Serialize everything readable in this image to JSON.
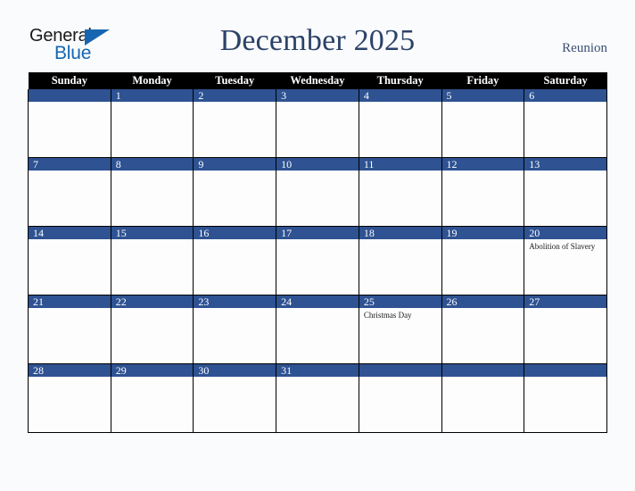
{
  "brand": {
    "name_top": "General",
    "name_bottom": "Blue",
    "triangle_icon": "triangle-icon",
    "color_black": "#1a1a1a",
    "color_blue": "#1565b0"
  },
  "header": {
    "title": "December 2025",
    "region": "Reunion",
    "title_color": "#2b4268"
  },
  "calendar": {
    "weekday_headers": [
      "Sunday",
      "Monday",
      "Tuesday",
      "Wednesday",
      "Thursday",
      "Friday",
      "Saturday"
    ],
    "header_bg": "#000000",
    "daynum_bg": "#2e5292",
    "cell_bg": "#fdfdfe",
    "weeks": [
      [
        {
          "day": "",
          "events": []
        },
        {
          "day": "1",
          "events": []
        },
        {
          "day": "2",
          "events": []
        },
        {
          "day": "3",
          "events": []
        },
        {
          "day": "4",
          "events": []
        },
        {
          "day": "5",
          "events": []
        },
        {
          "day": "6",
          "events": []
        }
      ],
      [
        {
          "day": "7",
          "events": []
        },
        {
          "day": "8",
          "events": []
        },
        {
          "day": "9",
          "events": []
        },
        {
          "day": "10",
          "events": []
        },
        {
          "day": "11",
          "events": []
        },
        {
          "day": "12",
          "events": []
        },
        {
          "day": "13",
          "events": []
        }
      ],
      [
        {
          "day": "14",
          "events": []
        },
        {
          "day": "15",
          "events": []
        },
        {
          "day": "16",
          "events": []
        },
        {
          "day": "17",
          "events": []
        },
        {
          "day": "18",
          "events": []
        },
        {
          "day": "19",
          "events": []
        },
        {
          "day": "20",
          "events": [
            "Abolition of Slavery"
          ]
        }
      ],
      [
        {
          "day": "21",
          "events": []
        },
        {
          "day": "22",
          "events": []
        },
        {
          "day": "23",
          "events": []
        },
        {
          "day": "24",
          "events": []
        },
        {
          "day": "25",
          "events": [
            "Christmas Day"
          ]
        },
        {
          "day": "26",
          "events": []
        },
        {
          "day": "27",
          "events": []
        }
      ],
      [
        {
          "day": "28",
          "events": []
        },
        {
          "day": "29",
          "events": []
        },
        {
          "day": "30",
          "events": []
        },
        {
          "day": "31",
          "events": []
        },
        {
          "day": "",
          "events": []
        },
        {
          "day": "",
          "events": []
        },
        {
          "day": "",
          "events": []
        }
      ]
    ]
  }
}
